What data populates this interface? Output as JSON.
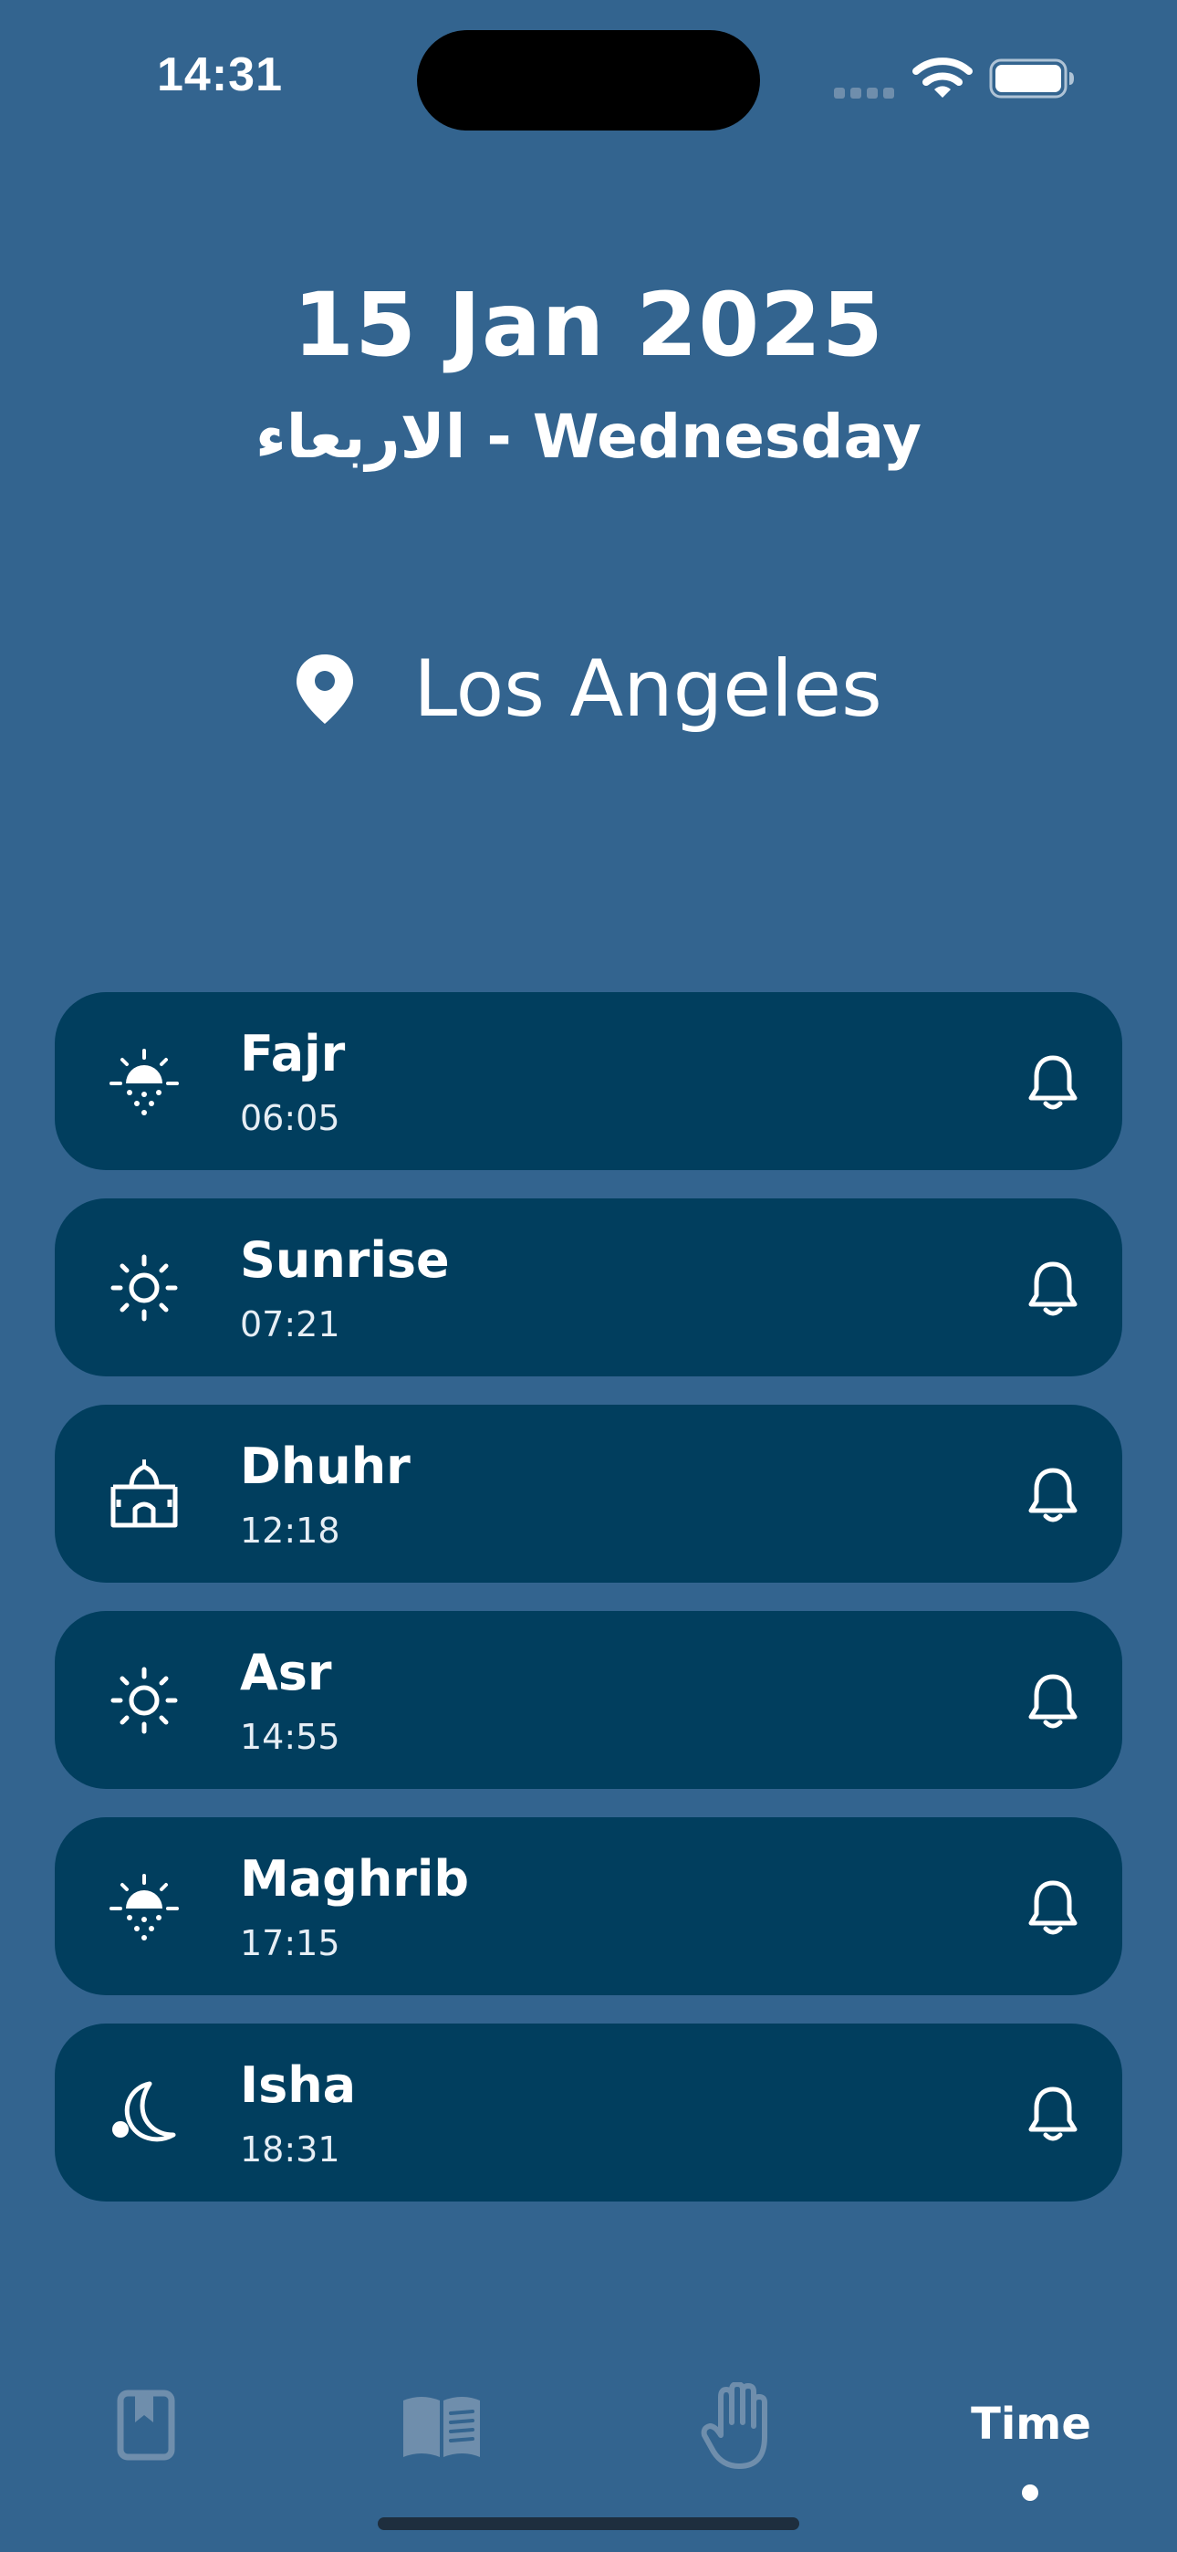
{
  "status_bar": {
    "time": "14:31",
    "signal_icon": "cellular-signal-icon",
    "wifi_icon": "wifi-icon",
    "battery_icon": "battery-full-icon"
  },
  "header": {
    "date": "15 Jan 2025",
    "weekday": "الاربعاء - Wednesday",
    "location_icon": "map-pin-icon",
    "location": "Los Angeles"
  },
  "prayers": [
    {
      "name": "Fajr",
      "time": "06:05",
      "icon": "sunrise-icon",
      "notification_icon": "bell-icon"
    },
    {
      "name": "Sunrise",
      "time": "07:21",
      "icon": "sun-icon",
      "notification_icon": "bell-icon"
    },
    {
      "name": "Dhuhr",
      "time": "12:18",
      "icon": "mosque-icon",
      "notification_icon": "bell-icon"
    },
    {
      "name": "Asr",
      "time": "14:55",
      "icon": "sun-icon",
      "notification_icon": "bell-icon"
    },
    {
      "name": "Maghrib",
      "time": "17:15",
      "icon": "sunset-icon",
      "notification_icon": "bell-icon"
    },
    {
      "name": "Isha",
      "time": "18:31",
      "icon": "moon-icon",
      "notification_icon": "bell-icon"
    }
  ],
  "tab_bar": {
    "tabs": [
      {
        "icon": "bookmark-book-icon",
        "active": false
      },
      {
        "icon": "open-book-icon",
        "active": false
      },
      {
        "icon": "praying-hand-icon",
        "active": false
      },
      {
        "label": "Time",
        "active": true
      }
    ]
  },
  "colors": {
    "background": "#33648F",
    "card": "#013E5E",
    "text": "#FFFFFF",
    "inactive_icon": "#6F8EAC"
  }
}
